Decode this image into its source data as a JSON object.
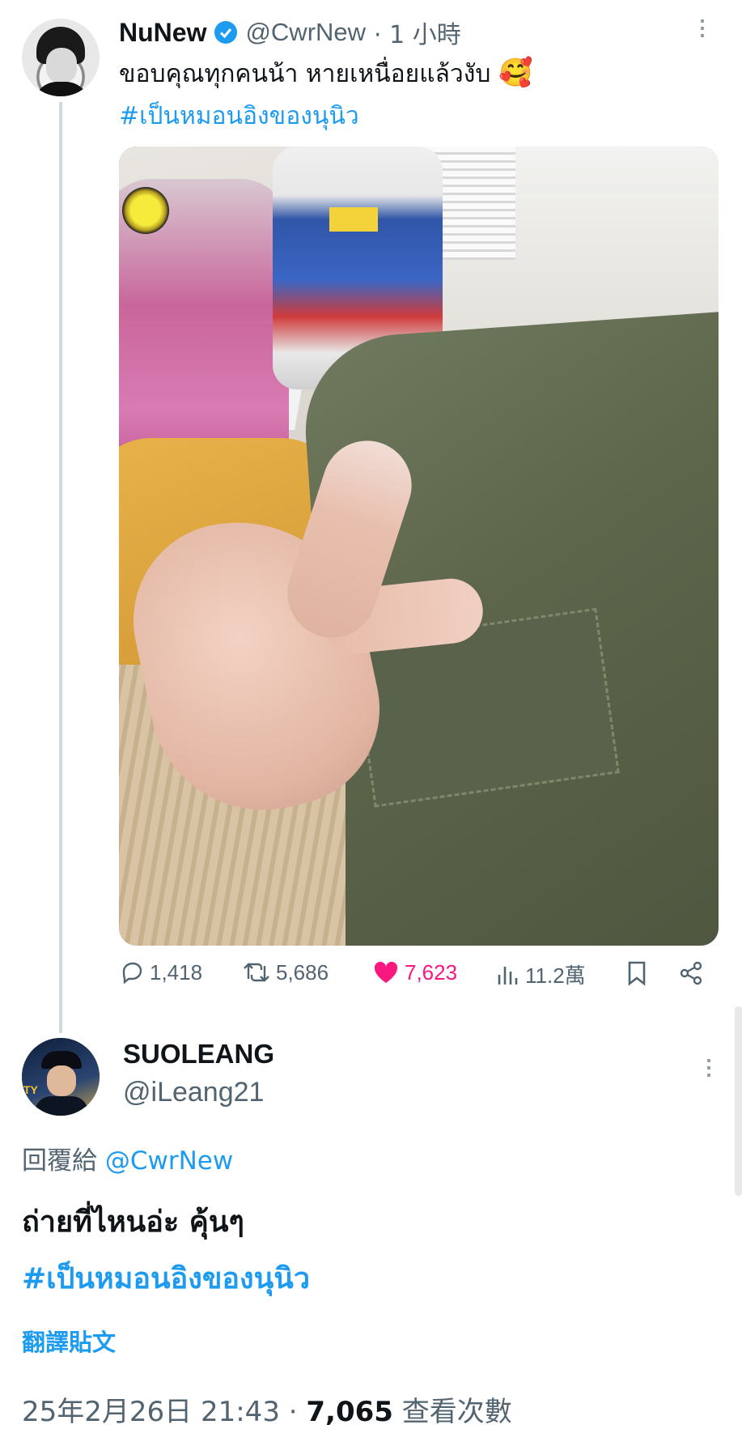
{
  "tweet": {
    "author_name": "NuNew",
    "handle": "@CwrNew",
    "time": "· 1 小時",
    "text": "ขอบคุณทุกคนน้า หายเหนื่อยแล้วงับ",
    "emoji": "🥰",
    "hashtag": "#เป็นหมอนอิงของนุนิว",
    "stats": {
      "replies": "1,418",
      "retweets": "5,686",
      "likes": "7,623",
      "views": "11.2萬"
    }
  },
  "reply": {
    "author_name": "SUOLEANG",
    "handle": "@iLeang21",
    "replying_to_label": "回覆給",
    "replying_to_handle": "@CwrNew",
    "text": "ถ่ายที่ไหนอ่ะ คุ้นๆ",
    "hashtag": "#เป็นหมอนอิงของนุนิว",
    "translate_label": "翻譯貼文",
    "timestamp": "25年2月26日 21:43",
    "views_count": "7,065",
    "views_label": "查看次數"
  },
  "icons": [
    "verified-icon",
    "more-icon",
    "reply-icon",
    "retweet-icon",
    "like-icon",
    "views-icon",
    "bookmark-icon",
    "share-icon"
  ],
  "colors": {
    "accent": "#1d9bf0",
    "like": "#f91880",
    "muted": "#536471"
  }
}
